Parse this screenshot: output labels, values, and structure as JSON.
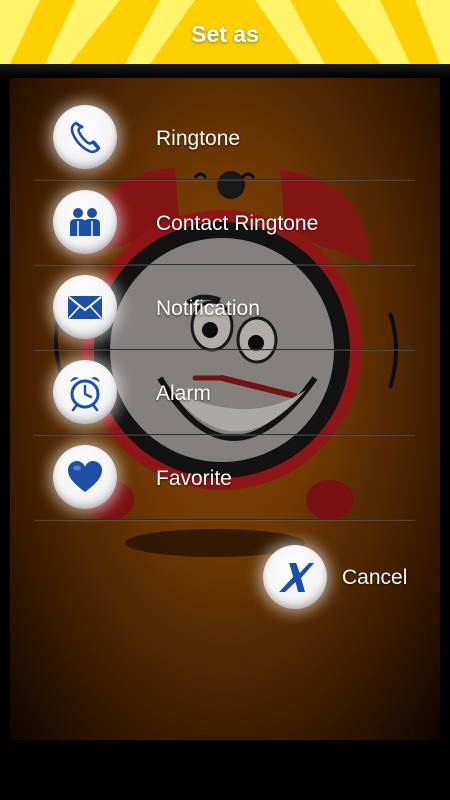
{
  "header": {
    "title": "Set as"
  },
  "menu": {
    "items": [
      {
        "label": "Ringtone",
        "icon": "phone-icon"
      },
      {
        "label": "Contact Ringtone",
        "icon": "contacts-icon"
      },
      {
        "label": "Notification",
        "icon": "envelope-icon"
      },
      {
        "label": "Alarm",
        "icon": "alarm-clock-icon"
      },
      {
        "label": "Favorite",
        "icon": "heart-icon"
      }
    ]
  },
  "cancel": {
    "label": "Cancel",
    "icon": "close-x-icon"
  },
  "colors": {
    "header_yellow": "#ffd200",
    "header_ray_light": "#fff36a",
    "icon_blue": "#1c4fa8",
    "background_orange": "#9a4e06"
  }
}
